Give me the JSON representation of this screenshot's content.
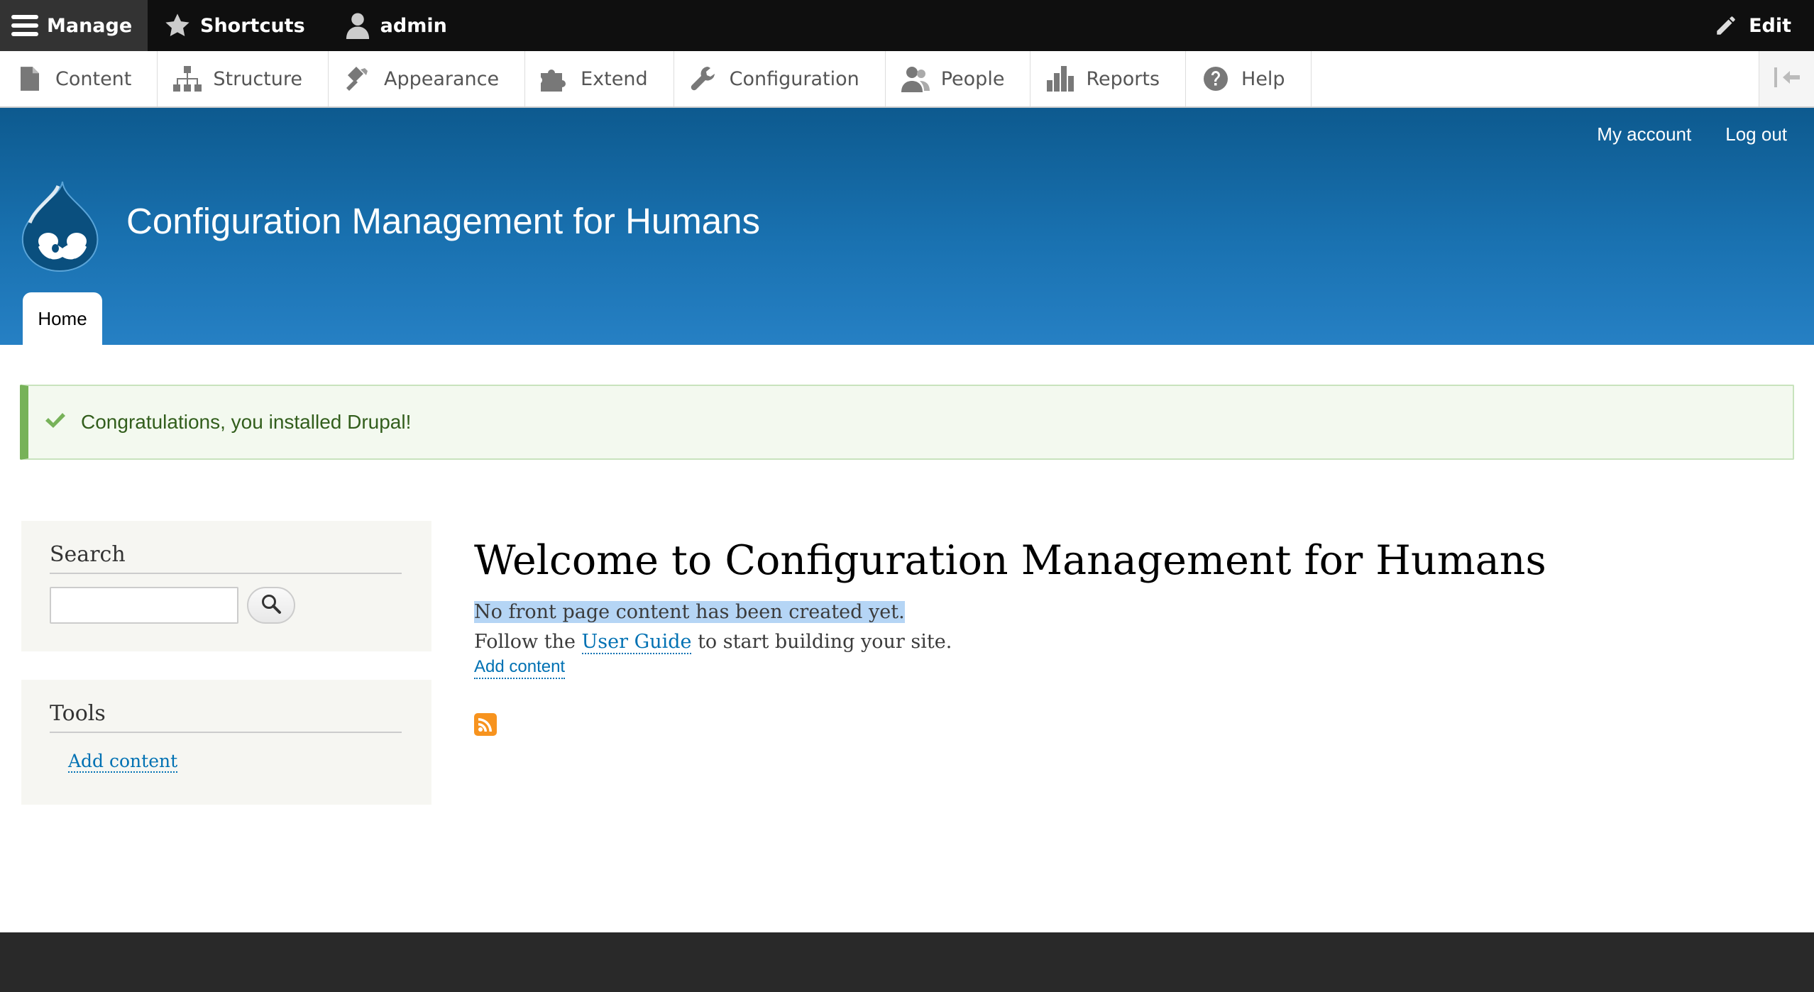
{
  "toolbar": {
    "manage_label": "Manage",
    "shortcuts_label": "Shortcuts",
    "user_label": "admin",
    "edit_label": "Edit"
  },
  "tray": {
    "items": [
      {
        "label": "Content",
        "icon": "file-icon"
      },
      {
        "label": "Structure",
        "icon": "sitemap-icon"
      },
      {
        "label": "Appearance",
        "icon": "paint-roller-icon"
      },
      {
        "label": "Extend",
        "icon": "puzzle-icon"
      },
      {
        "label": "Configuration",
        "icon": "wrench-icon"
      },
      {
        "label": "People",
        "icon": "people-icon"
      },
      {
        "label": "Reports",
        "icon": "bar-chart-icon"
      },
      {
        "label": "Help",
        "icon": "help-icon"
      }
    ]
  },
  "header": {
    "my_account": "My account",
    "log_out": "Log out",
    "site_name": "Configuration Management for Humans",
    "home_tab": "Home"
  },
  "status": {
    "message": "Congratulations, you installed Drupal!"
  },
  "sidebar": {
    "search_title": "Search",
    "tools_title": "Tools",
    "tools_link": "Add content"
  },
  "main": {
    "title": "Welcome to Configuration Management for Humans",
    "no_content": "No front page content has been created yet.",
    "follow_prefix": "Follow the ",
    "user_guide": "User Guide",
    "follow_suffix": " to start building your site.",
    "add_content": "Add content"
  },
  "colors": {
    "header_blue": "#1971b0",
    "link_blue": "#0071b3",
    "success_green": "#77b259",
    "rss_orange": "#f7931e"
  }
}
